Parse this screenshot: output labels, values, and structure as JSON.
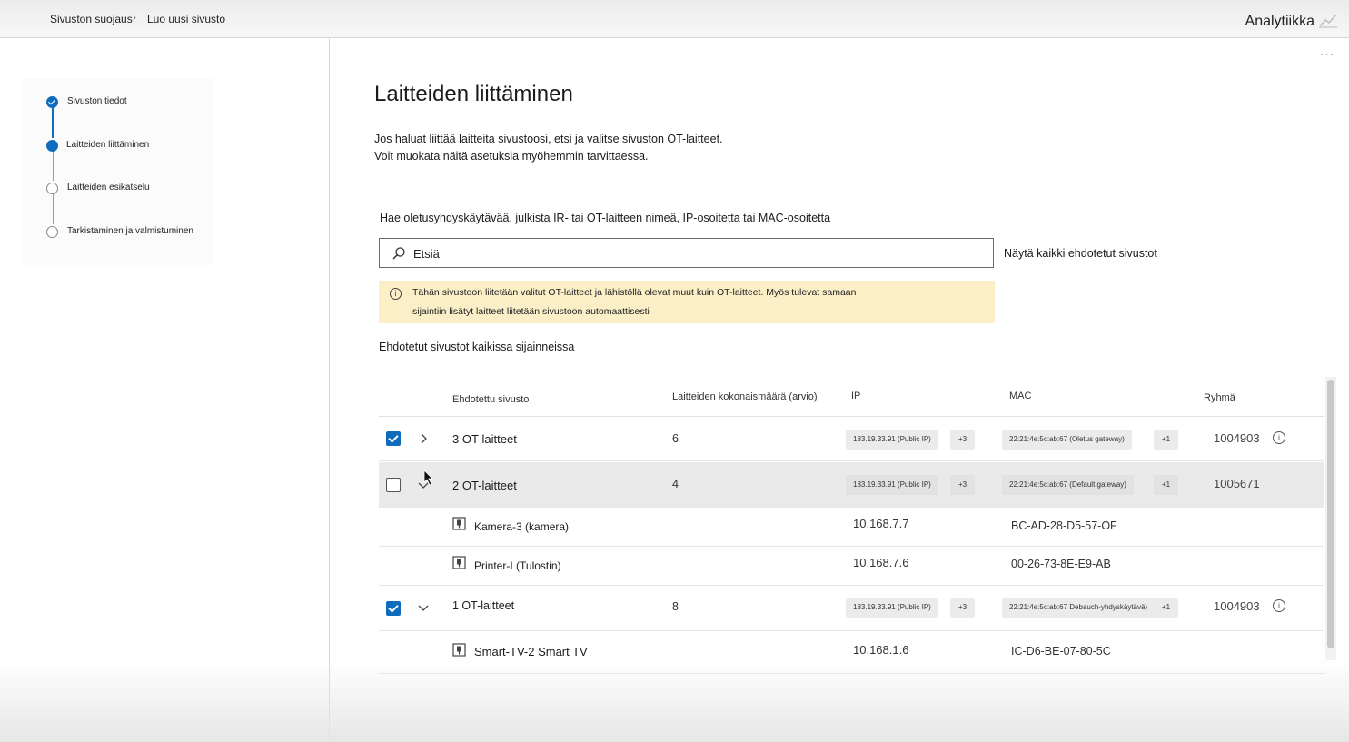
{
  "topbar": {
    "breadcrumb": [
      "Sivuston suojaus",
      "Luo uusi sivusto"
    ],
    "analytics_label": "Analytiikka",
    "more_label": "···"
  },
  "steps": [
    {
      "label": "Sivuston tiedot",
      "status": "done"
    },
    {
      "label": "Laitteiden liittäminen",
      "status": "current"
    },
    {
      "label": "Laitteiden esikatselu",
      "status": "todo"
    },
    {
      "label": "Tarkistaminen ja valmistuminen",
      "status": "todo"
    }
  ],
  "main": {
    "title": "Laitteiden liittäminen",
    "description_line1": "Jos haluat liittää laitteita sivustoosi, etsi ja valitse sivuston OT-laitteet.",
    "description_line2": "Voit muokata näitä asetuksia myöhemmin tarvittaessa.",
    "search_label": "Hae oletusyhdyskäytävää, julkista IR- tai OT-laitteen nimeä, IP-osoitetta tai MAC-osoitetta",
    "search_placeholder": "Etsiä",
    "show_all_label": "Näytä kaikki ehdotetut sivustot",
    "notice_line1": "Tähän sivustoon liitetään valitut OT-laitteet ja lähistöllä olevat muut kuin OT-laitteet. Myös tulevat samaan",
    "notice_line2": "sijaintiin lisätyt laitteet liitetään sivustoon automaattisesti",
    "suggested_title": "Ehdotetut sivustot kaikissa sijainneissa"
  },
  "table": {
    "headers": {
      "site": "Ehdotettu sivusto",
      "count": "Laitteiden kokonaismäärä (arvio)",
      "ip": "IP",
      "mac": "MAC",
      "group": "Ryhmä"
    },
    "rows": [
      {
        "checked": true,
        "expanded": false,
        "name": "3 OT-laitteet",
        "count": "6",
        "ip": "183.19.33.91 (Public IP)",
        "ip_more": "+3",
        "mac": "22:21:4e:5c:ab:67 (Oletus   gateway)",
        "mac_more": "+1",
        "group": "1004903",
        "has_info": true
      },
      {
        "checked": false,
        "expanded": true,
        "name": "2 OT-laitteet",
        "count": "4",
        "ip": "183.19.33.91 (Public IP)",
        "ip_more": "+3",
        "mac": "22:21:4e:5c:ab:67 (Default gateway)",
        "mac_more": "+1",
        "group": "1005671",
        "has_info": false
      },
      {
        "checked": true,
        "expanded": true,
        "name": "1 OT-laitteet",
        "count": "8",
        "ip": "183.19.33.91 (Public IP)",
        "ip_more": "+3",
        "mac": "22:21:4e:5c:ab:67 Debauch-yhdyskäytävä)",
        "mac_more": "+1",
        "group": "1004903",
        "has_info": true
      }
    ],
    "devices": [
      {
        "name": "Kamera-3 (kamera)",
        "ip": "10.168.7.7",
        "mac": "BC-AD-28-D5-57-OF"
      },
      {
        "name": "Printer-I (Tulostin)",
        "ip": "10.168.7.6",
        "mac": "00-26-73-8E-E9-AB"
      },
      {
        "name": "Smart-TV-2 Smart TV",
        "ip": "10.168.1.6",
        "mac": "IC-D6-BE-07-80-5C"
      }
    ]
  },
  "colors": {
    "accent": "#0f6cbd",
    "notice_bg": "#fbefc8",
    "row_highlight": "#eaeaea"
  },
  "icons": [
    "check-icon",
    "search-icon",
    "info-icon",
    "chevron-right-icon",
    "chevron-down-icon",
    "device-icon",
    "analytics-icon",
    "more-icon"
  ]
}
